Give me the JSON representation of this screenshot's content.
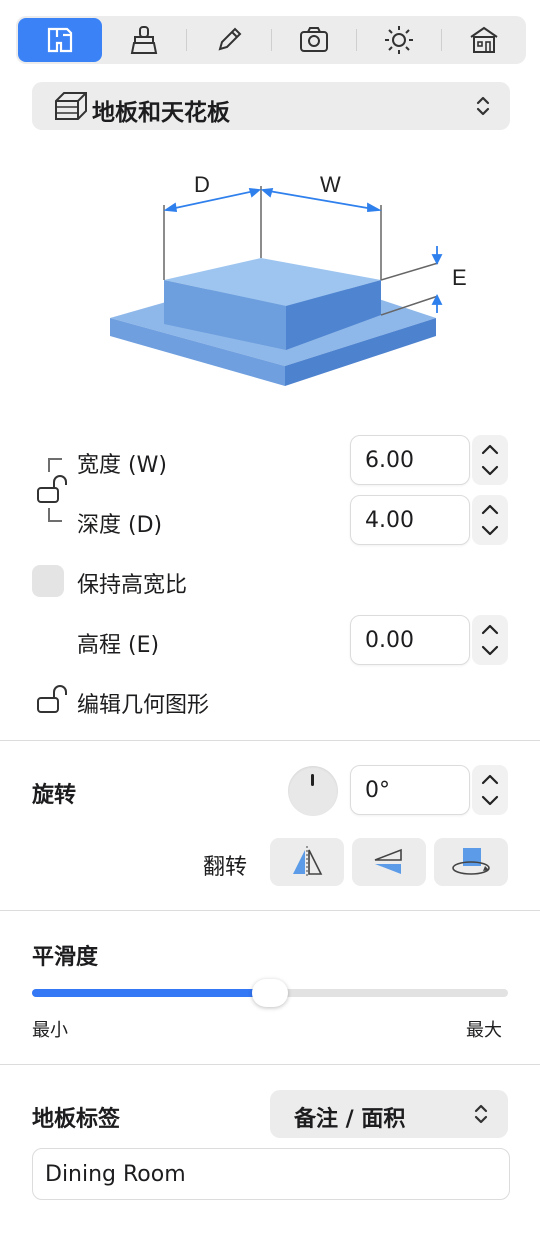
{
  "tabs": [
    {
      "icon": "floor-plan-icon",
      "active": true
    },
    {
      "icon": "brush-icon",
      "active": false
    },
    {
      "icon": "pencil-icon",
      "active": false
    },
    {
      "icon": "camera-icon",
      "active": false
    },
    {
      "icon": "sun-icon",
      "active": false
    },
    {
      "icon": "house-icon",
      "active": false
    }
  ],
  "category": {
    "label": "地板和天花板",
    "icon": "floor-ceiling-icon"
  },
  "diagram": {
    "label_d": "D",
    "label_w": "W",
    "label_e": "E"
  },
  "dimensions": {
    "width_label": "宽度 (W)",
    "width_value": "6.00",
    "depth_label": "深度 (D)",
    "depth_value": "4.00",
    "keep_ratio_label": "保持高宽比",
    "elevation_label": "高程 (E)",
    "elevation_value": "0.00",
    "edit_geometry_label": "编辑几何图形"
  },
  "rotation": {
    "title": "旋转",
    "value": "0°",
    "flip_label": "翻转"
  },
  "smoothness": {
    "title": "平滑度",
    "min_label": "最小",
    "max_label": "最大",
    "value_fraction": 0.5
  },
  "floor_label": {
    "title": "地板标签",
    "option": "备注 / 面积",
    "text": "Dining Room"
  },
  "colors": {
    "accent": "#3b82f6",
    "slider": "#3478f6",
    "panel": "#ececec"
  }
}
